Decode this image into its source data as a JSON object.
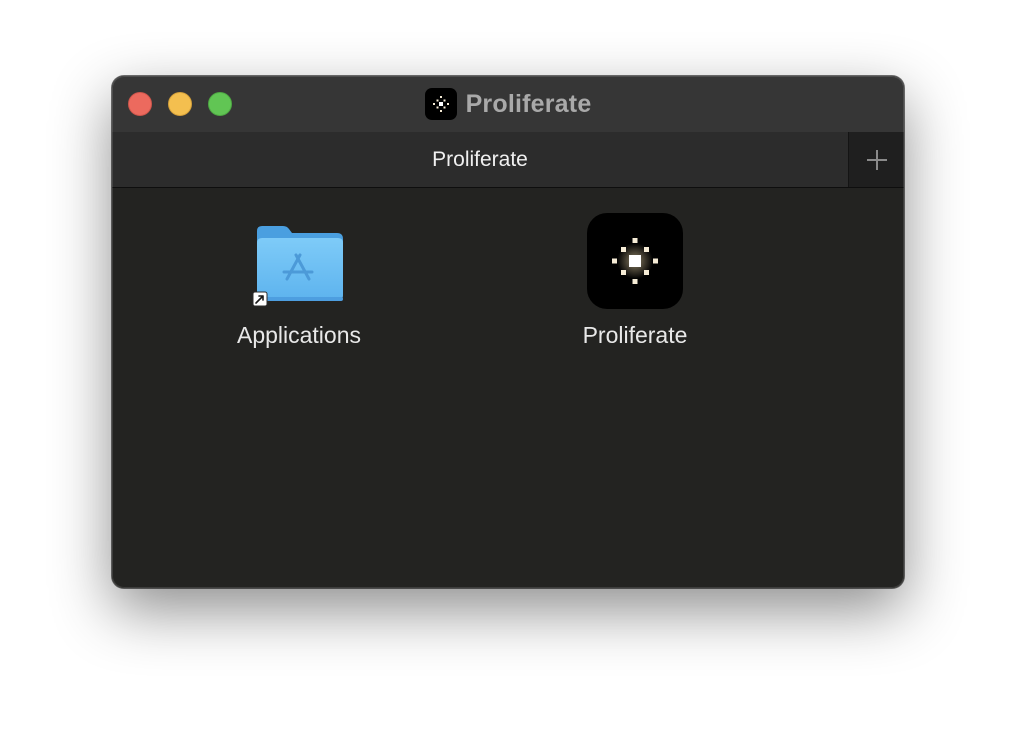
{
  "window": {
    "title": "Proliferate",
    "title_icon": "proliferate-app-icon"
  },
  "tabbar": {
    "tabs": [
      {
        "label": "Proliferate",
        "active": true
      }
    ],
    "new_tab_icon": "plus-icon"
  },
  "content": {
    "items": [
      {
        "label": "Applications",
        "icon": "applications-folder-alias-icon"
      },
      {
        "label": "Proliferate",
        "icon": "proliferate-app-icon"
      }
    ]
  },
  "colors": {
    "titlebar": "#363636",
    "tabbar": "#2c2c2c",
    "content_bg": "#232321",
    "close": "#ec6a5e",
    "minimize": "#f4bf4f",
    "zoom": "#61c554",
    "folder_blue": "#6cbcf2"
  }
}
